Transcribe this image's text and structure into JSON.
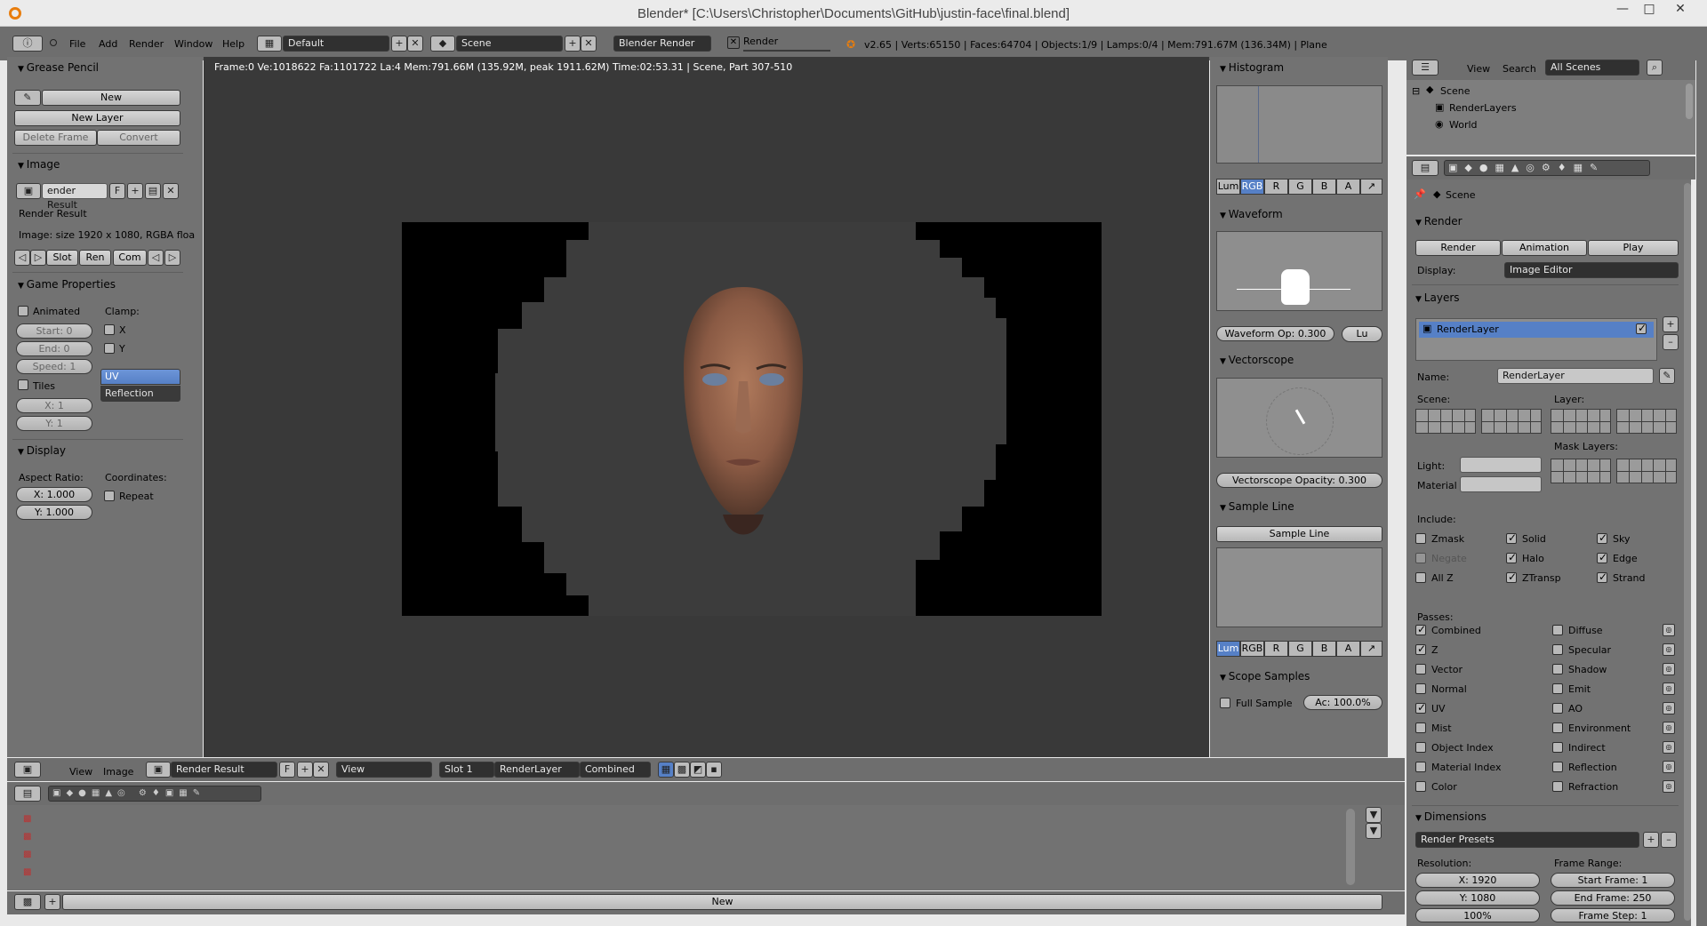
{
  "window": {
    "title": "Blender* [C:\\Users\\Christopher\\Documents\\GitHub\\justin-face\\final.blend]",
    "minimize": "—",
    "maximize": "□",
    "close": "✕"
  },
  "info_header": {
    "menus": [
      "File",
      "Add",
      "Render",
      "Window",
      "Help"
    ],
    "screen_layout": "Default",
    "scene": "Scene",
    "render_engine": "Blender Render",
    "render_progress_label": "Render",
    "stats": "v2.65 | Verts:65150 | Faces:64704 | Objects:1/9 | Lamps:0/4 | Mem:791.67M (136.34M) | Plane"
  },
  "left_panel": {
    "grease_pencil": {
      "title": "Grease Pencil",
      "new": "New",
      "new_layer": "New Layer",
      "delete_frame": "Delete Frame",
      "convert": "Convert"
    },
    "image": {
      "title": "Image",
      "image_name": "ender Result",
      "fake_user": "F",
      "name": "Render Result",
      "info": "Image: size 1920 x 1080, RGBA floa",
      "slot": "Slot",
      "render": "Ren",
      "combined": "Com"
    },
    "game_properties": {
      "title": "Game Properties",
      "animated": "Animated",
      "start": "Start: 0",
      "end": "End: 0",
      "speed": "Speed: 1",
      "tiles": "Tiles",
      "x": "X: 1",
      "y": "Y: 1",
      "clamp": "Clamp:",
      "clamp_x": "X",
      "clamp_y": "Y",
      "uv_coordinates": "UV Coordinates",
      "reflection": "Reflection"
    },
    "display": {
      "title": "Display",
      "aspect_ratio": "Aspect Ratio:",
      "aspect_x": "X: 1.000",
      "aspect_y": "Y: 1.000",
      "coordinates": "Coordinates:",
      "repeat": "Repeat"
    }
  },
  "viewport": {
    "render_info": "Frame:0 Ve:1018622 Fa:1101722 La:4 Mem:791.66M (135.92M, peak 1911.62M) Time:02:53.31 | Scene, Part 307-510"
  },
  "scopes": {
    "histogram": "Histogram",
    "channels": [
      "Lum",
      "RGB",
      "R",
      "G",
      "B",
      "A"
    ],
    "histogram_active": "RGB",
    "waveform": "Waveform",
    "waveform_opacity": "Waveform Op: 0.300",
    "waveform_mode": "Lu",
    "vectorscope": "Vectorscope",
    "vectorscope_opacity": "Vectorscope Opacity: 0.300",
    "sample_line": "Sample Line",
    "sample_line_button": "Sample Line",
    "sample_channels_active": "Lum",
    "scope_samples": "Scope Samples",
    "full_sample": "Full Sample",
    "accuracy": "Ac: 100.0%"
  },
  "image_header": {
    "menus": [
      "View",
      "Image"
    ],
    "image": "Render Result",
    "fake_user": "F",
    "view_mode": "View",
    "slot": "Slot 1",
    "layer": "RenderLayer",
    "pass": "Combined"
  },
  "timeline": {
    "new_button": "New"
  },
  "outliner": {
    "menus": [
      "View",
      "Search"
    ],
    "filter": "All Scenes",
    "items": [
      "Scene",
      "RenderLayers",
      "World"
    ]
  },
  "properties": {
    "context": "Scene",
    "render": {
      "title": "Render",
      "render": "Render",
      "animation": "Animation",
      "play": "Play",
      "display_label": "Display:",
      "display_value": "Image Editor"
    },
    "layers": {
      "title": "Layers",
      "layer": "RenderLayer",
      "name_label": "Name:",
      "name_value": "RenderLayer",
      "scene_label": "Scene:",
      "layer_label": "Layer:",
      "mask_layers": "Mask Layers:",
      "light": "Light:",
      "material": "Material",
      "include": "Include:",
      "include_items": [
        {
          "label": "Zmask",
          "on": false
        },
        {
          "label": "Solid",
          "on": true
        },
        {
          "label": "Sky",
          "on": true
        },
        {
          "label": "Negate",
          "on": false
        },
        {
          "label": "Halo",
          "on": true
        },
        {
          "label": "Edge",
          "on": true
        },
        {
          "label": "All Z",
          "on": false
        },
        {
          "label": "ZTransp",
          "on": true
        },
        {
          "label": "Strand",
          "on": true
        }
      ],
      "passes": "Passes:",
      "passes_left": [
        {
          "label": "Combined",
          "on": true
        },
        {
          "label": "Z",
          "on": true
        },
        {
          "label": "Vector",
          "on": false
        },
        {
          "label": "Normal",
          "on": false
        },
        {
          "label": "UV",
          "on": true
        },
        {
          "label": "Mist",
          "on": false
        },
        {
          "label": "Object Index",
          "on": false
        },
        {
          "label": "Material Index",
          "on": false
        },
        {
          "label": "Color",
          "on": false
        }
      ],
      "passes_right": [
        {
          "label": "Diffuse",
          "on": false
        },
        {
          "label": "Specular",
          "on": false
        },
        {
          "label": "Shadow",
          "on": false
        },
        {
          "label": "Emit",
          "on": false
        },
        {
          "label": "AO",
          "on": false
        },
        {
          "label": "Environment",
          "on": false
        },
        {
          "label": "Indirect",
          "on": false
        },
        {
          "label": "Reflection",
          "on": false
        },
        {
          "label": "Refraction",
          "on": false
        }
      ]
    },
    "dimensions": {
      "title": "Dimensions",
      "presets": "Render Presets",
      "resolution": "Resolution:",
      "res_x": "X: 1920",
      "res_y": "Y: 1080",
      "res_pct": "100%",
      "frame_range": "Frame Range:",
      "start_frame": "Start Frame: 1",
      "end_frame": "End Frame: 250",
      "frame_step": "Frame Step: 1"
    }
  },
  "colors": {
    "accent_blue": "#5680c6",
    "panel_gray": "#727272",
    "viewport_bg": "#393939"
  }
}
